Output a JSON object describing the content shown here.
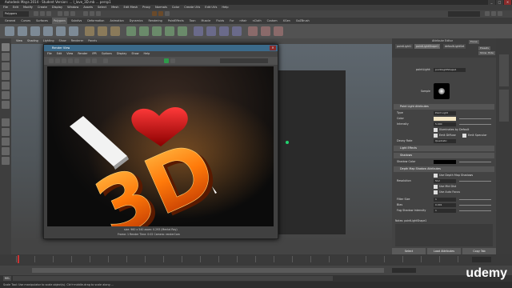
{
  "window": {
    "title": "Autodesk Maya 2014 - Student Version: ... I_love_3D.mb ... persp1",
    "min": "_",
    "max": "□",
    "close": "✕"
  },
  "menus": [
    "File",
    "Edit",
    "Modify",
    "Create",
    "Display",
    "Window",
    "Assets",
    "Select",
    "Mesh",
    "Edit Mesh",
    "Proxy",
    "Normals",
    "Color",
    "Create UVs",
    "Edit UVs",
    "Help"
  ],
  "mode": "Polygons",
  "shelf_tabs": [
    "General",
    "Curves",
    "Surfaces",
    "Polygons",
    "Subdivs",
    "Deformation",
    "Animation",
    "Dynamics",
    "Rendering",
    "PaintEffects",
    "Toon",
    "Muscle",
    "Fluids",
    "Fur",
    "nHair",
    "nCloth",
    "Custom",
    "XGen",
    "GoZBrush"
  ],
  "active_shelf": "Polygons",
  "viewport_menu": [
    "View",
    "Shading",
    "Lighting",
    "Show",
    "Renderer",
    "Panels"
  ],
  "render_view": {
    "title": "Render View",
    "menu": [
      "File",
      "Edit",
      "View",
      "Render",
      "IPR",
      "Options",
      "Display",
      "Show",
      "Help"
    ],
    "image_text": {
      "i": "I",
      "heart": "♥",
      "three_d": "3D"
    },
    "info_line1": "size: 960 x 540  zoom: 0.293   (Mental Ray)",
    "info_line2": "Frame: 1     Render Time: 0:02     Camera: renderCam"
  },
  "attribute_editor": {
    "title": "Attribute Editor",
    "tabs": [
      "pointLight1",
      "pointLightShape1",
      "defaultLightSet"
    ],
    "node_label": "pointLight:",
    "node_value": "pointLightShape1",
    "focus_btn": "Focus",
    "presets_btn": "Presets",
    "show_btn": "Show",
    "hide_btn": "Hide",
    "sample_label": "Sample",
    "sections": {
      "point": "Point Light Attributes",
      "light_effects": "Light Effects",
      "shadows": "Shadows",
      "depth_map": "Depth Map Shadow Attributes"
    },
    "fields": {
      "type_label": "Type",
      "type_value": "Point Light",
      "color_label": "Color",
      "intensity_label": "Intensity",
      "intensity_value": "5.000",
      "illum_default": "Illuminates by Default",
      "emit_diffuse": "Emit Diffuse",
      "emit_specular": "Emit Specular",
      "decay_label": "Decay Rate",
      "decay_value": "Quadratic",
      "shadow_color_label": "Shadow Color",
      "use_depth": "Use Depth Map Shadows",
      "resolution_label": "Resolution",
      "resolution_value": "512",
      "use_mid": "Use Mid Dist",
      "use_auto": "Use Auto Focus",
      "filter_label": "Filter Size",
      "filter_value": "1",
      "bias_label": "Bias",
      "bias_value": "0.001",
      "fog_label": "Fog Shadow Intensity",
      "fog_value": "1"
    },
    "notes": "Notes: pointLightShape1",
    "buttons": [
      "Select",
      "Load Attributes",
      "Copy Tab"
    ]
  },
  "timeline": {
    "ticks": [
      "1",
      "2",
      "4",
      "6",
      "8",
      "10",
      "12",
      "14",
      "16",
      "18",
      "20",
      "22",
      "24"
    ]
  },
  "help_line": "Scale Tool: Use manipulator to scale object(s). Ctrl+middle-drag to scale along ...",
  "watermark": "udemy",
  "colors": {
    "accent": "#3b6a8a",
    "marker": "#21d26e",
    "heart": "#d01818",
    "three_d": "#ff7a0a"
  }
}
